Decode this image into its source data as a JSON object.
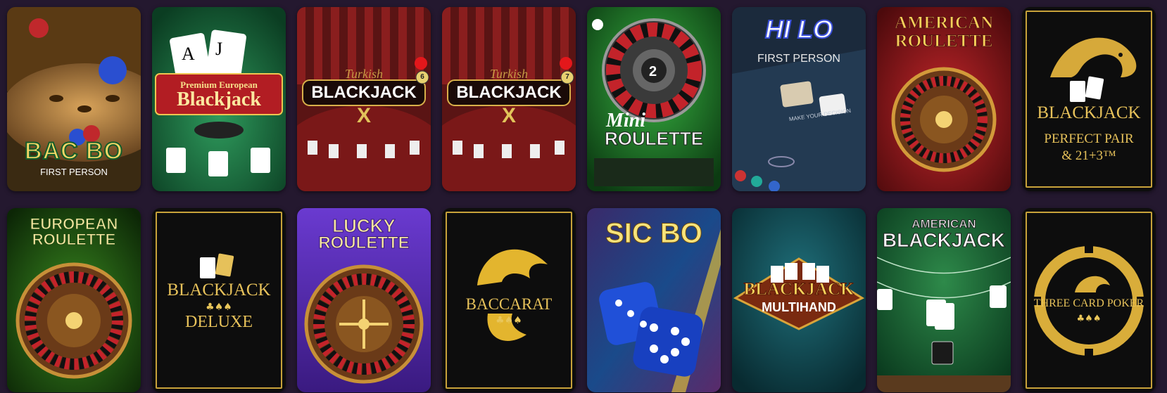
{
  "games": [
    {
      "name": "BAC BO",
      "badge": "FIRST PERSON"
    },
    {
      "top": "Premium European",
      "name": "Blackjack"
    },
    {
      "top": "Turkish",
      "name": "BLACKJACK",
      "badge": "X",
      "chip": "6"
    },
    {
      "top": "Turkish",
      "name": "BLACKJACK",
      "badge": "X",
      "chip": "7"
    },
    {
      "top": "Mini",
      "name": "ROULETTE"
    },
    {
      "name": "HI LO",
      "badge": "FIRST PERSON",
      "note": "MAKE YOUR DECISION"
    },
    {
      "top": "AMERICAN",
      "name": "ROULETTE"
    },
    {
      "name": "BLACKJACK",
      "line2": "PERFECT PAIR",
      "line3": "& 21+3™"
    },
    {
      "top": "EUROPEAN",
      "name": "ROULETTE"
    },
    {
      "name": "BLACKJACK",
      "suits": "♣♠♠",
      "line2": "DELUXE"
    },
    {
      "top": "LUCKY",
      "name": "ROULETTE"
    },
    {
      "name": "BACCARAT",
      "suits": "♣♠♠"
    },
    {
      "name": "SIC BO"
    },
    {
      "name": "BLACKJACK",
      "line2": "MULTIHAND"
    },
    {
      "top": "AMERICAN",
      "name": "BLACKJACK"
    },
    {
      "name": "THREE CARD POKER",
      "suits": "♣♠♠"
    }
  ],
  "colors": {
    "page_bg": "#24182f",
    "gold": "#f3cf55",
    "frame_gold": "#c8a23a"
  }
}
